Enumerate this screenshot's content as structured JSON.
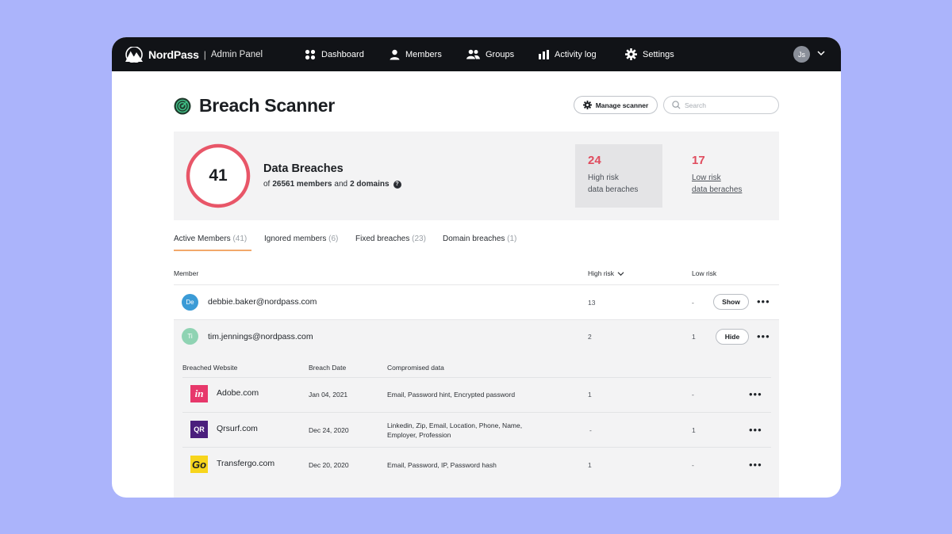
{
  "header": {
    "brand": "NordPass",
    "separator": "|",
    "subtitle": "Admin Panel",
    "nav": [
      {
        "label": "Dashboard",
        "icon": "dashboard-icon"
      },
      {
        "label": "Members",
        "icon": "user-icon"
      },
      {
        "label": "Groups",
        "icon": "group-icon"
      },
      {
        "label": "Activity log",
        "icon": "bar-chart-icon"
      },
      {
        "label": "Settings",
        "icon": "gear-icon"
      }
    ],
    "user_initials": "Js"
  },
  "page": {
    "title": "Breach Scanner",
    "manage_label": "Manage scanner",
    "search_placeholder": "Search"
  },
  "summary": {
    "total": "41",
    "title": "Data Breaches",
    "of": "of",
    "members": "26561 members",
    "and": "and",
    "domains": "2 domains",
    "help": "?",
    "high": {
      "count": "24",
      "line1": "High risk",
      "line2": "data beraches"
    },
    "low": {
      "count": "17",
      "line1": "Low risk",
      "line2": "data beraches"
    }
  },
  "tabs": [
    {
      "label": "Active Members",
      "count": "(41)"
    },
    {
      "label": "Ignored members",
      "count": "(6)"
    },
    {
      "label": "Fixed breaches",
      "count": "(23)"
    },
    {
      "label": "Domain breaches",
      "count": "(1)"
    }
  ],
  "table": {
    "col_member": "Member",
    "col_high": "High risk",
    "col_low": "Low risk",
    "rows": [
      {
        "initials": "De",
        "email": "debbie.baker@nordpass.com",
        "high": "13",
        "low": "-",
        "action": "Show"
      },
      {
        "initials": "Ti",
        "email": "tim.jennings@nordpass.com",
        "high": "2",
        "low": "1",
        "action": "Hide"
      }
    ]
  },
  "breaches": {
    "col_site": "Breached Website",
    "col_date": "Breach Date",
    "col_data": "Compromised data",
    "rows": [
      {
        "logo": "in",
        "site": "Adobe.com",
        "date": "Jan 04, 2021",
        "data": "Email, Password hint, Encrypted password",
        "high": "1",
        "low": "-"
      },
      {
        "logo": "QR",
        "site": "Qrsurf.com",
        "date": "Dec 24, 2020",
        "data": "Linkedin, Zip, Email, Location, Phone, Name, Employer, Profession",
        "high": "-",
        "low": "1"
      },
      {
        "logo": "Go",
        "site": "Transfergo.com",
        "date": "Dec 20, 2020",
        "data": "Email, Password, IP, Password hash",
        "high": "1",
        "low": "-"
      }
    ]
  },
  "colors": {
    "accent_red": "#e04c5e",
    "tab_underline": "#f2a86b",
    "topbar": "#111317",
    "background": "#abb4fb"
  }
}
